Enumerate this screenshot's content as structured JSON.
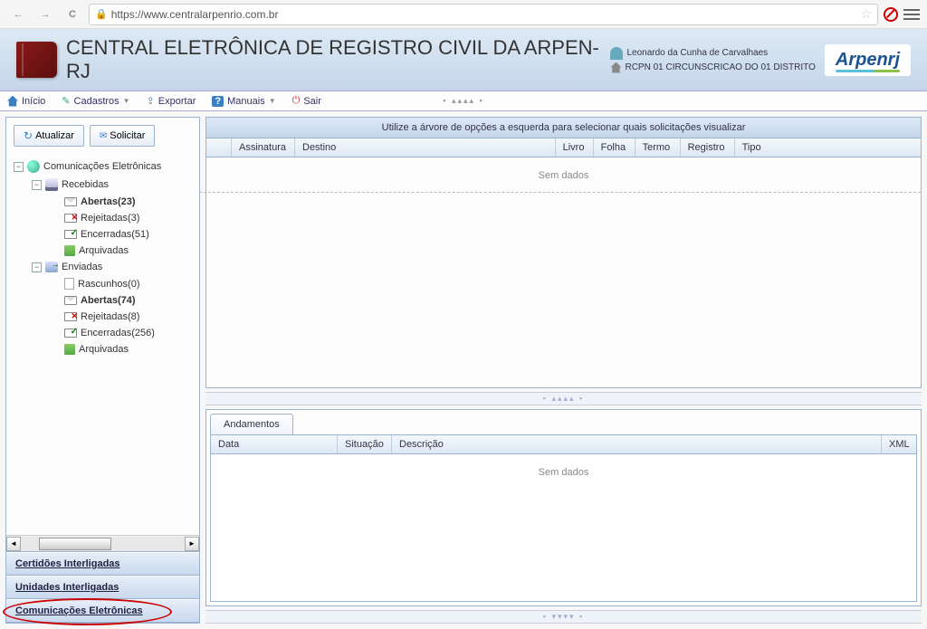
{
  "browser": {
    "url": "https://www.centralarpenrio.com.br"
  },
  "header": {
    "title": "CENTRAL ELETRÔNICA DE REGISTRO CIVIL DA ARPEN-RJ",
    "user_name": "Leonardo da Cunha de Carvalhaes",
    "user_office": "RCPN 01 CIRCUNSCRICAO DO 01 DISTRITO",
    "logo_text": "Arpenrj"
  },
  "menubar": {
    "inicio": "Início",
    "cadastros": "Cadastros",
    "exportar": "Exportar",
    "manuais": "Manuais",
    "sair": "Sair"
  },
  "sidebar": {
    "btn_atualizar": "Atualizar",
    "btn_solicitar": "Solicitar",
    "tree": {
      "root": "Comunicações Eletrônicas",
      "recebidas": "Recebidas",
      "recebidas_abertas": "Abertas(23)",
      "recebidas_rejeitadas": "Rejeitadas(3)",
      "recebidas_encerradas": "Encerradas(51)",
      "recebidas_arquivadas": "Arquivadas",
      "enviadas": "Enviadas",
      "enviadas_rascunhos": "Rascunhos(0)",
      "enviadas_abertas": "Abertas(74)",
      "enviadas_rejeitadas": "Rejeitadas(8)",
      "enviadas_encerradas": "Encerradas(256)",
      "enviadas_arquivadas": "Arquivadas"
    },
    "stack": {
      "certidoes": "Certidões Interligadas",
      "unidades": "Unidades Interligadas",
      "comunicacoes": "Comunicações Eletrônicas"
    }
  },
  "content": {
    "instruction": "Utilize a árvore de opções a esquerda para selecionar quais solicitações visualizar",
    "columns": {
      "assinatura": "Assinatura",
      "destino": "Destino",
      "livro": "Livro",
      "folha": "Folha",
      "termo": "Termo",
      "registro": "Registro",
      "tipo": "Tipo"
    },
    "empty": "Sem dados",
    "tab_andamentos": "Andamentos",
    "detail_columns": {
      "data": "Data",
      "situacao": "Situação",
      "descricao": "Descrição",
      "xml": "XML"
    }
  }
}
